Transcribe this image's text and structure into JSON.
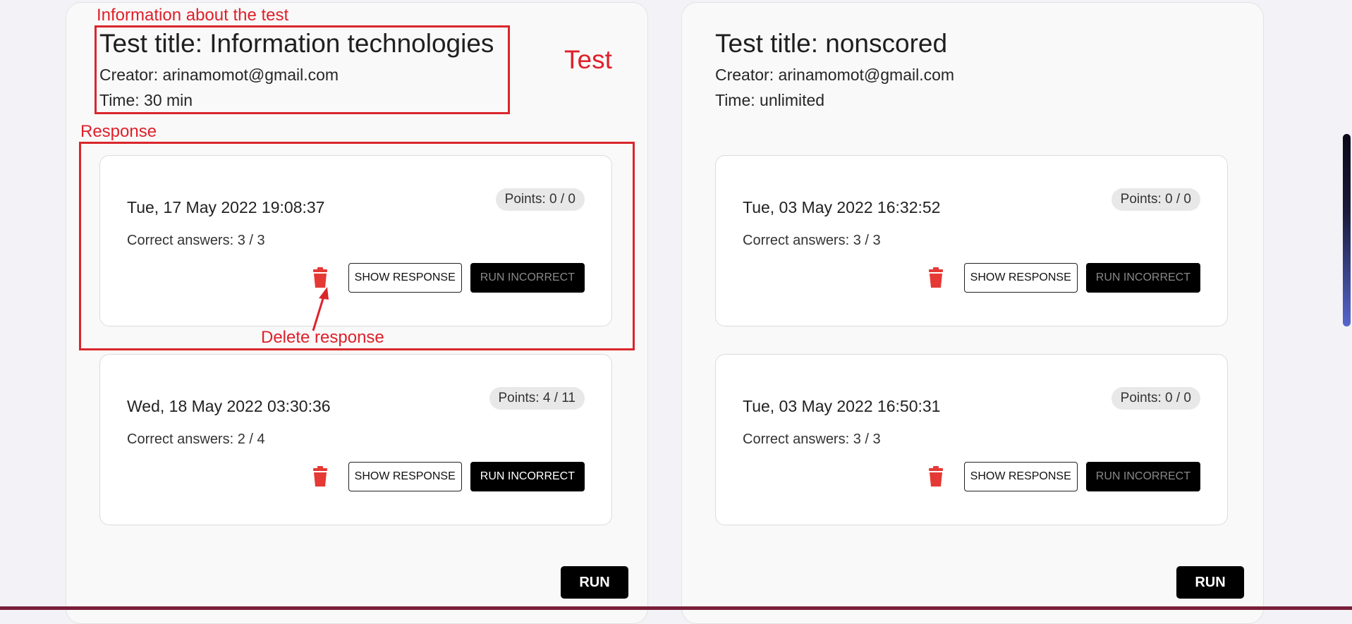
{
  "tests": [
    {
      "title": "Test title: Information technologies",
      "creator": "Creator: arinamomot@gmail.com",
      "time": "Time: 30 min",
      "responses": [
        {
          "date": "Tue, 17 May 2022 19:08:37",
          "correct": "Correct answers: 3 / 3",
          "points": "Points: 0 / 0",
          "show_label": "SHOW RESPONSE",
          "run_incorrect_label": "RUN INCORRECT",
          "run_incorrect_enabled": false
        },
        {
          "date": "Wed, 18 May 2022 03:30:36",
          "correct": "Correct answers: 2 / 4",
          "points": "Points: 4 / 11",
          "show_label": "SHOW RESPONSE",
          "run_incorrect_label": "RUN INCORRECT",
          "run_incorrect_enabled": true
        }
      ],
      "run_label": "RUN"
    },
    {
      "title": "Test title: nonscored",
      "creator": "Creator: arinamomot@gmail.com",
      "time": "Time: unlimited",
      "responses": [
        {
          "date": "Tue, 03 May 2022 16:32:52",
          "correct": "Correct answers: 3 / 3",
          "points": "Points: 0 / 0",
          "show_label": "SHOW RESPONSE",
          "run_incorrect_label": "RUN INCORRECT",
          "run_incorrect_enabled": false
        },
        {
          "date": "Tue, 03 May 2022 16:50:31",
          "correct": "Correct answers: 3 / 3",
          "points": "Points: 0 / 0",
          "show_label": "SHOW RESPONSE",
          "run_incorrect_label": "RUN INCORRECT",
          "run_incorrect_enabled": false
        }
      ],
      "run_label": "RUN"
    }
  ],
  "annotations": {
    "info_label": "Information about the test",
    "test_label": "Test",
    "response_label": "Response",
    "delete_label": "Delete response",
    "color": "#e0202a"
  },
  "icons": {
    "delete": "trash-icon"
  },
  "colors": {
    "delete_icon": "#e53935",
    "run_button": "#000000",
    "page_bg": "#f3f2f7"
  }
}
